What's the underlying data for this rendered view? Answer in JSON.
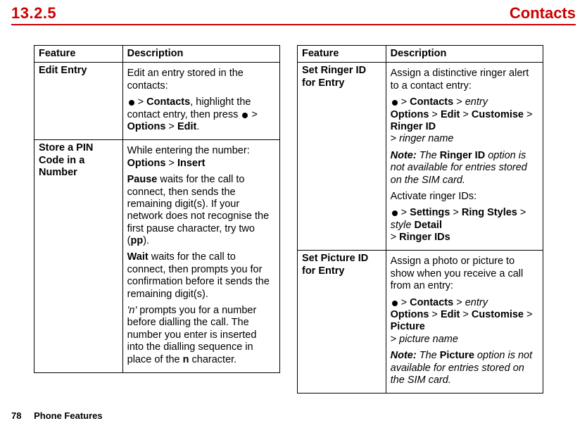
{
  "header": {
    "section_number": "13.2.5",
    "section_title": "Contacts"
  },
  "left": {
    "head_feature": "Feature",
    "head_desc": "Description",
    "row1": {
      "feature": "Edit Entry",
      "p1": "Edit an entry stored in the contacts:",
      "p2a": " > ",
      "p2b": "Contacts",
      "p2c": ", highlight the contact entry, then press ",
      "p2d": " > ",
      "p2e": "Options",
      "p2f": " > ",
      "p2g": "Edit",
      "p2h": "."
    },
    "row2": {
      "feature": "Store a PIN Code in a Number",
      "p1a": "While entering the number:",
      "p1b": "Options",
      "p1c": " > ",
      "p1d": "Insert",
      "p2a": "Pause",
      "p2b": " waits for the call to connect, then sends the remaining digit(s). If your network does not recognise the first pause character, try two (",
      "p2c": "pp",
      "p2d": ").",
      "p3a": "Wait",
      "p3b": " waits for the call to connect, then prompts you for confirmation before it sends the remaining digit(s).",
      "p4a": "'n'",
      "p4b": " prompts you for a number before dialling the call. The number you enter is inserted into the dialling sequence in place of the ",
      "p4c": "n",
      "p4d": " character."
    }
  },
  "right": {
    "head_feature": "Feature",
    "head_desc": "Description",
    "row1": {
      "feature": "Set Ringer ID for Entry",
      "p1": "Assign a distinctive ringer alert to a contact entry:",
      "p2a": " > ",
      "p2b": "Contacts",
      "p2c": " > ",
      "p2d": "entry",
      "p3a": "Options",
      "p3b": " > ",
      "p3c": "Edit",
      "p3d": " > ",
      "p3e": "Customise",
      "p3f": " > ",
      "p3g": "Ringer ID",
      "p4a": "> ",
      "p4b": "ringer name",
      "note1a": "Note:",
      "note1b": " The ",
      "note1c": "Ringer ID",
      "note1d": " option is not available for entries stored on the SIM card.",
      "p5": "Activate ringer IDs:",
      "p6a": " > ",
      "p6b": "Settings",
      "p6c": " > ",
      "p6d": "Ring Styles",
      "p6e": " > ",
      "p6f": "style",
      "p6g": " ",
      "p6h": "Detail",
      "p7a": "> ",
      "p7b": "Ringer IDs"
    },
    "row2": {
      "feature": "Set Picture ID for Entry",
      "p1": "Assign a photo or picture to show when you receive a call from an entry:",
      "p2a": " > ",
      "p2b": "Contacts",
      "p2c": " > ",
      "p2d": "entry",
      "p3a": "Options",
      "p3b": " > ",
      "p3c": "Edit",
      "p3d": " > ",
      "p3e": "Customise",
      "p3f": " > ",
      "p3g": "Picture",
      "p4a": "> ",
      "p4b": "picture name",
      "note1a": "Note:",
      "note1b": " The ",
      "note1c": "Picture",
      "note1d": " option is not available for entries stored on the SIM card."
    }
  },
  "footer": {
    "page": "78",
    "label": "Phone Features"
  }
}
